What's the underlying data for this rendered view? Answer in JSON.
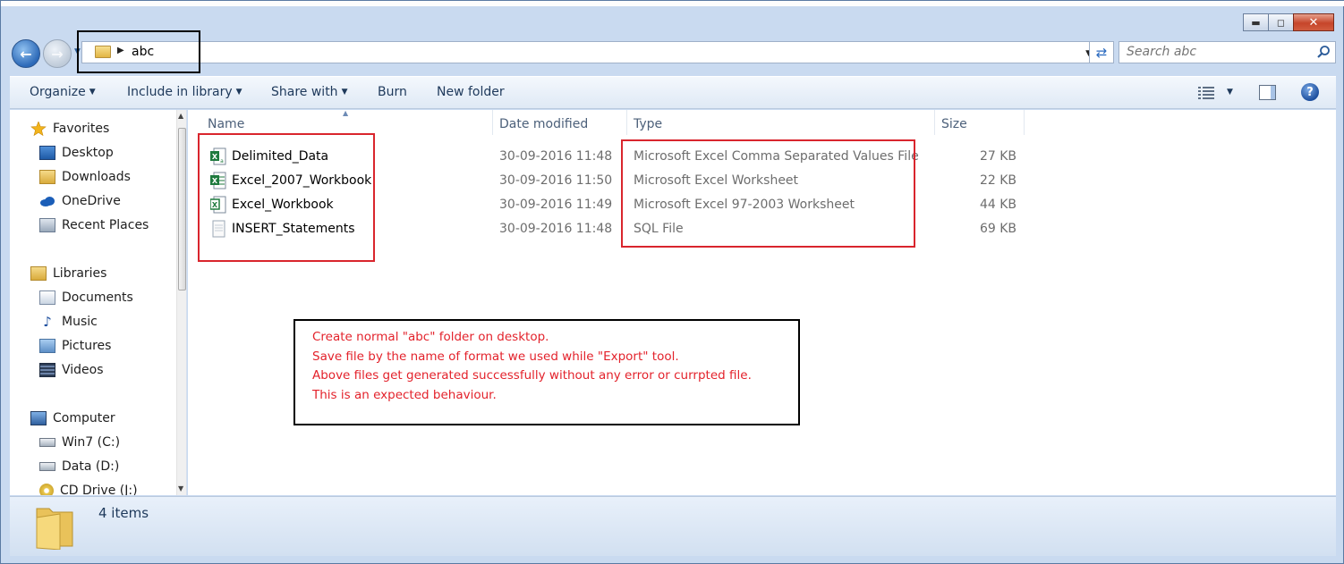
{
  "window": {
    "caption_buttons": {
      "minimize_icon": "minimize-icon",
      "maximize_icon": "maximize-icon",
      "close_icon": "close-icon"
    }
  },
  "navigation": {
    "back_icon": "back-arrow-icon",
    "forward_icon": "forward-arrow-icon",
    "address": {
      "folder_icon": "folder-icon",
      "path": [
        "abc"
      ]
    },
    "search": {
      "placeholder": "Search abc",
      "value": ""
    }
  },
  "toolbar": {
    "organize": "Organize",
    "include_in_library": "Include in library",
    "share_with": "Share with",
    "burn": "Burn",
    "new_folder": "New folder"
  },
  "sidebar": {
    "groups": [
      {
        "label": "Favorites",
        "icon": "star-icon",
        "items": [
          {
            "label": "Desktop",
            "icon": "desktop-icon"
          },
          {
            "label": "Downloads",
            "icon": "downloads-icon"
          },
          {
            "label": "OneDrive",
            "icon": "onedrive-icon"
          },
          {
            "label": "Recent Places",
            "icon": "recent-places-icon"
          }
        ]
      },
      {
        "label": "Libraries",
        "icon": "libraries-icon",
        "items": [
          {
            "label": "Documents",
            "icon": "documents-icon"
          },
          {
            "label": "Music",
            "icon": "music-icon"
          },
          {
            "label": "Pictures",
            "icon": "pictures-icon"
          },
          {
            "label": "Videos",
            "icon": "videos-icon"
          }
        ]
      },
      {
        "label": "Computer",
        "icon": "computer-icon",
        "items": [
          {
            "label": "Win7 (C:)",
            "icon": "drive-icon"
          },
          {
            "label": "Data (D:)",
            "icon": "drive-icon"
          },
          {
            "label": "CD Drive (J:)",
            "icon": "cd-drive-icon"
          }
        ]
      }
    ]
  },
  "file_list": {
    "columns": [
      "Name",
      "Date modified",
      "Type",
      "Size"
    ],
    "rows": [
      {
        "name": "Delimited_Data",
        "date": "30-09-2016 11:48",
        "type": "Microsoft Excel Comma Separated Values File",
        "size": "27 KB",
        "icon": "excel-csv-icon"
      },
      {
        "name": "Excel_2007_Workbook",
        "date": "30-09-2016 11:50",
        "type": "Microsoft Excel Worksheet",
        "size": "22 KB",
        "icon": "excel-workbook-icon"
      },
      {
        "name": "Excel_Workbook",
        "date": "30-09-2016 11:49",
        "type": "Microsoft Excel 97-2003 Worksheet",
        "size": "44 KB",
        "icon": "excel-97-icon"
      },
      {
        "name": "INSERT_Statements",
        "date": "30-09-2016 11:48",
        "type": "SQL File",
        "size": "69 KB",
        "icon": "sql-file-icon"
      }
    ]
  },
  "annotation": {
    "lines": [
      "Create normal \"abc\" folder on desktop.",
      "Save file by the name of format we used while \"Export\" tool.",
      "Above files get generated successfully without any error or currpted file.",
      "This is an expected behaviour."
    ]
  },
  "statusbar": {
    "count": "4 items"
  },
  "colors": {
    "annotation_red": "#e3222b",
    "highlight_red": "#d9252d",
    "chrome_blue": "#c9daf0"
  }
}
